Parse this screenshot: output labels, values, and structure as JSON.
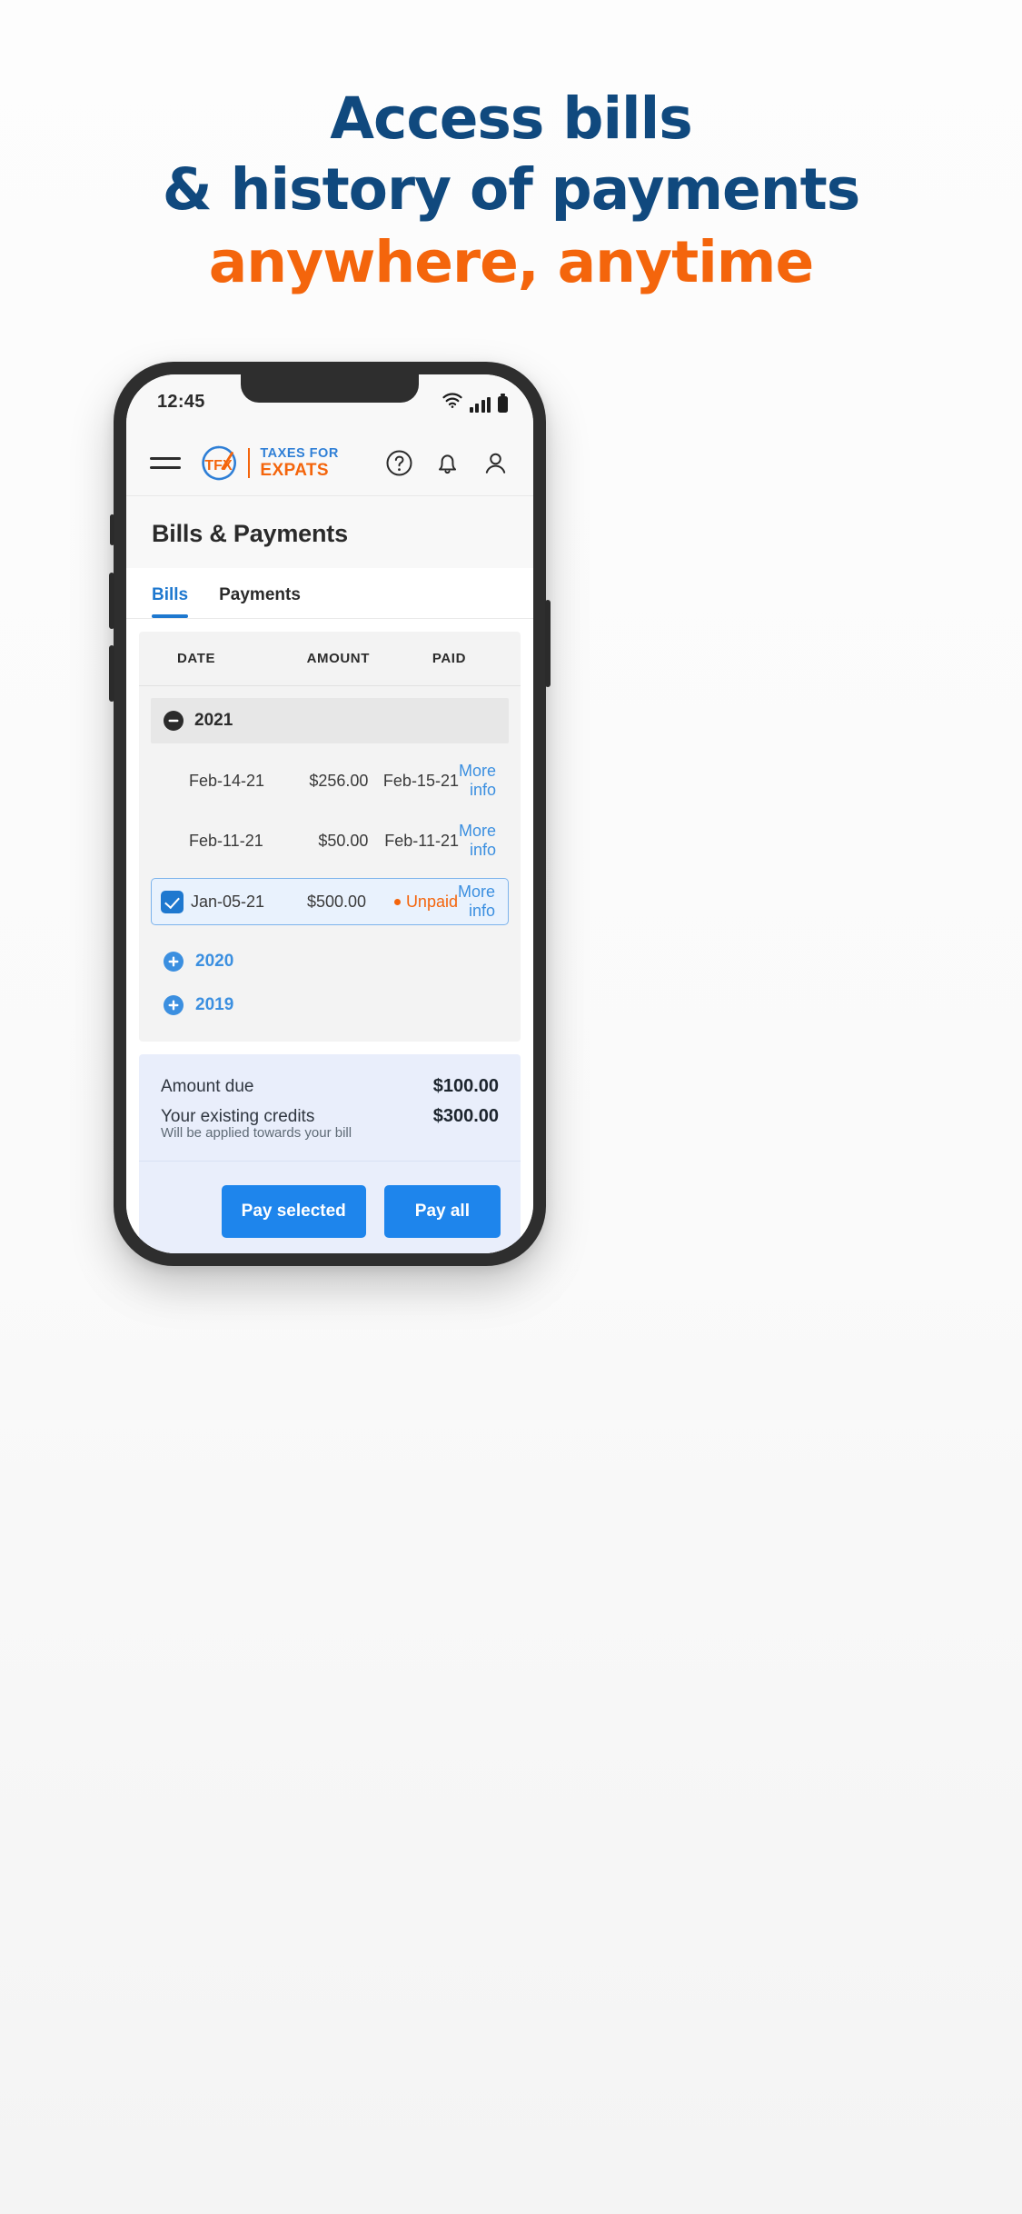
{
  "headline": {
    "line1": "Access bills",
    "line2": "& history of payments",
    "line3": "anywhere, anytime",
    "color_primary": "#10497e",
    "color_accent": "#f4650c"
  },
  "phone": {
    "status_bar": {
      "time": "12:45",
      "icons": [
        "wifi-icon",
        "signal-bars-icon",
        "battery-icon"
      ]
    },
    "app_header": {
      "menu_icon": "hamburger-menu-icon",
      "logo": {
        "mark_text": "TFX",
        "word_top": "TAXES FOR",
        "word_bottom": "EXPATS",
        "mark_circle_color": "#2f7fd6",
        "mark_text_color": "#f4650c"
      },
      "actions": [
        "help-icon",
        "notification-bell-icon",
        "user-profile-icon"
      ]
    },
    "page_title": "Bills & Payments",
    "tabs": [
      {
        "label": "Bills",
        "active": true
      },
      {
        "label": "Payments",
        "active": false
      }
    ],
    "bills_table": {
      "columns": [
        "DATE",
        "AMOUNT",
        "PAID"
      ],
      "groups": [
        {
          "year": "2021",
          "expanded": true,
          "toggle_icon": "minus-circle-icon",
          "rows": [
            {
              "date": "Feb-14-21",
              "amount": "$256.00",
              "paid": "Feb-15-21",
              "paid_status": "date",
              "link": "More info",
              "selected": false
            },
            {
              "date": "Feb-11-21",
              "amount": "$50.00",
              "paid": "Feb-11-21",
              "paid_status": "date",
              "link": "More info",
              "selected": false
            },
            {
              "date": "Jan-05-21",
              "amount": "$500.00",
              "paid": "Unpaid",
              "paid_status": "unpaid",
              "link": "More info",
              "selected": true
            }
          ]
        },
        {
          "year": "2020",
          "expanded": false,
          "toggle_icon": "plus-circle-icon",
          "rows": []
        },
        {
          "year": "2019",
          "expanded": false,
          "toggle_icon": "plus-circle-icon",
          "rows": []
        }
      ]
    },
    "summary": {
      "amount_due_label": "Amount due",
      "amount_due_value": "$100.00",
      "credits_label": "Your existing credits",
      "credits_value": "$300.00",
      "credits_note": "Will be applied towards your bill",
      "pay_selected_label": "Pay selected",
      "pay_all_label": "Pay all",
      "button_color": "#1e85ec",
      "panel_color": "#e9eefb"
    }
  }
}
